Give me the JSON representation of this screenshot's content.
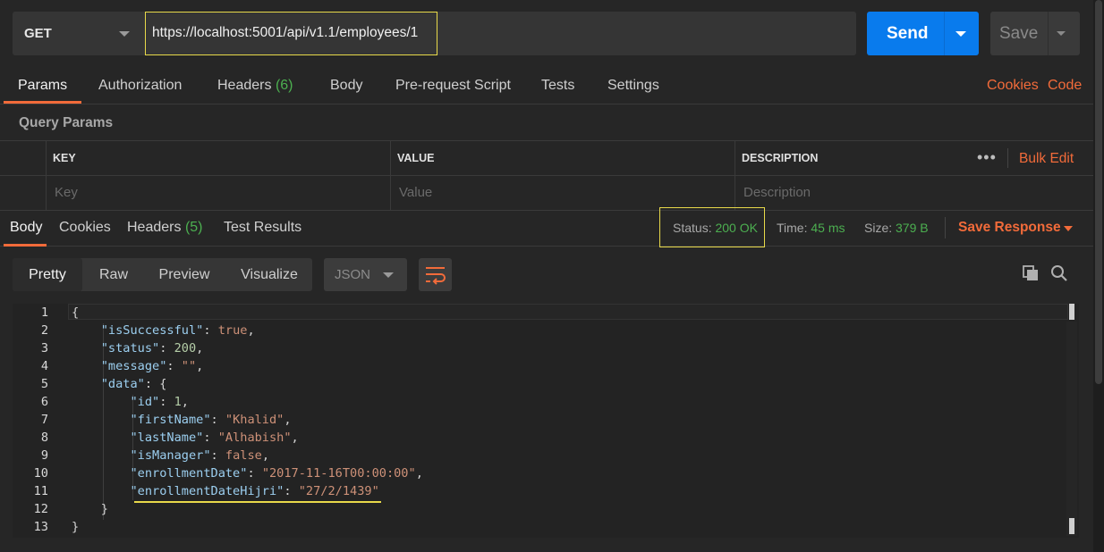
{
  "request": {
    "method": "GET",
    "url": "https://localhost:5001/api/v1.1/employees/1",
    "send_label": "Send",
    "save_label": "Save"
  },
  "req_tabs": [
    {
      "label": "Params"
    },
    {
      "label": "Authorization"
    },
    {
      "label": "Headers",
      "count": "(6)"
    },
    {
      "label": "Body"
    },
    {
      "label": "Pre-request Script"
    },
    {
      "label": "Tests"
    },
    {
      "label": "Settings"
    }
  ],
  "links": {
    "cookies": "Cookies",
    "code": "Code"
  },
  "query_params": {
    "title": "Query Params",
    "headers": [
      "KEY",
      "VALUE",
      "DESCRIPTION"
    ],
    "placeholders": [
      "Key",
      "Value",
      "Description"
    ],
    "more": "•••",
    "bulk_edit": "Bulk Edit"
  },
  "res_tabs": [
    {
      "label": "Body"
    },
    {
      "label": "Cookies"
    },
    {
      "label": "Headers",
      "count": "(5)"
    },
    {
      "label": "Test Results"
    }
  ],
  "response_meta": {
    "status_label": "Status:",
    "status_value": "200 OK",
    "time_label": "Time:",
    "time_value": "45 ms",
    "size_label": "Size:",
    "size_value": "379 B",
    "save_response": "Save Response"
  },
  "format": {
    "buttons": [
      "Pretty",
      "Raw",
      "Preview",
      "Visualize"
    ],
    "language": "JSON"
  },
  "colors": {
    "accent": "#f26b3a",
    "send": "#097bed",
    "success": "#4caf50",
    "highlight": "#e8d94a"
  },
  "code_lines": [
    {
      "n": "1",
      "html": "<span class='p'>{</span>"
    },
    {
      "n": "2",
      "html": "    <span class='k'>\"isSuccessful\"</span><span class='p'>: </span><span class='b'>true</span><span class='p'>,</span>"
    },
    {
      "n": "3",
      "html": "    <span class='k'>\"status\"</span><span class='p'>: </span><span class='n'>200</span><span class='p'>,</span>"
    },
    {
      "n": "4",
      "html": "    <span class='k'>\"message\"</span><span class='p'>: </span><span class='s'>\"\"</span><span class='p'>,</span>"
    },
    {
      "n": "5",
      "html": "    <span class='k'>\"data\"</span><span class='p'>: {</span>"
    },
    {
      "n": "6",
      "html": "        <span class='k'>\"id\"</span><span class='p'>: </span><span class='n'>1</span><span class='p'>,</span>"
    },
    {
      "n": "7",
      "html": "        <span class='k'>\"firstName\"</span><span class='p'>: </span><span class='s'>\"Khalid\"</span><span class='p'>,</span>"
    },
    {
      "n": "8",
      "html": "        <span class='k'>\"lastName\"</span><span class='p'>: </span><span class='s'>\"Alhabish\"</span><span class='p'>,</span>"
    },
    {
      "n": "9",
      "html": "        <span class='k'>\"isManager\"</span><span class='p'>: </span><span class='b'>false</span><span class='p'>,</span>"
    },
    {
      "n": "10",
      "html": "        <span class='k'>\"enrollmentDate\"</span><span class='p'>: </span><span class='s'>\"2017-11-16T00:00:00\"</span><span class='p'>,</span>"
    },
    {
      "n": "11",
      "html": "        <span class='k'>\"enrollmentDateHijri\"</span><span class='p'>: </span><span class='s'>\"27/2/1439\"</span>"
    },
    {
      "n": "12",
      "html": "    <span class='p'>}</span>"
    },
    {
      "n": "13",
      "html": "<span class='p'>}</span>"
    }
  ]
}
